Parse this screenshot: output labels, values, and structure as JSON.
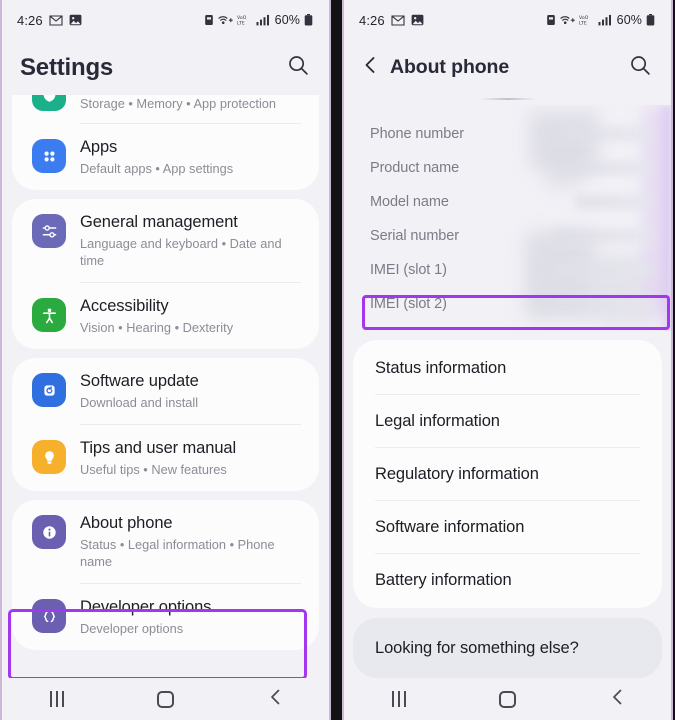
{
  "status_bar": {
    "time": "4:26",
    "left_icons": [
      "gmail-icon",
      "gallery-icon"
    ],
    "right_icons": [
      "alarm-icon",
      "wifi-calling-icon",
      "volte-icon",
      "signal-icon"
    ],
    "battery_percent": "60%"
  },
  "nav_bar": {
    "recents_label": "recents-button",
    "home_label": "home-button",
    "back_label": "back-button"
  },
  "left_screen": {
    "title": "Settings",
    "search_icon": "search-icon",
    "groups": [
      {
        "items": [
          {
            "title": "",
            "subtitle": "Storage  •  Memory  •  App protection",
            "icon": "device-care-icon",
            "icon_color": "#19b08a",
            "clipped": true
          },
          {
            "title": "Apps",
            "subtitle": "Default apps  •  App settings",
            "icon": "apps-grid-icon",
            "icon_color": "#3b7df0",
            "clipped": false
          }
        ]
      },
      {
        "items": [
          {
            "title": "General management",
            "subtitle": "Language and keyboard  •  Date and time",
            "icon": "sliders-icon",
            "icon_color": "#6a6ab8",
            "clipped": false
          },
          {
            "title": "Accessibility",
            "subtitle": "Vision  •  Hearing  •  Dexterity",
            "icon": "accessibility-icon",
            "icon_color": "#2bab3f",
            "clipped": false
          }
        ]
      },
      {
        "items": [
          {
            "title": "Software update",
            "subtitle": "Download and install",
            "icon": "software-update-icon",
            "icon_color": "#2f6fe0",
            "clipped": false
          },
          {
            "title": "Tips and user manual",
            "subtitle": "Useful tips  •  New features",
            "icon": "lightbulb-icon",
            "icon_color": "#f6b02c",
            "clipped": false
          }
        ]
      },
      {
        "items": [
          {
            "title": "About phone",
            "subtitle": "Status  •  Legal information  •  Phone name",
            "icon": "info-circle-icon",
            "icon_color": "#6a5fb0",
            "clipped": false,
            "highlighted": true
          },
          {
            "title": "Developer options",
            "subtitle": "Developer options",
            "icon": "braces-icon",
            "icon_color": "#6a5fb0",
            "clipped": false
          }
        ]
      }
    ]
  },
  "right_screen": {
    "title": "About phone",
    "back_icon": "chevron-left-icon",
    "search_icon": "search-icon",
    "info_rows": [
      {
        "label": "Phone number",
        "value_redacted": true
      },
      {
        "label": "Product name",
        "value_redacted": true
      },
      {
        "label": "Model name",
        "value_redacted": true,
        "highlighted": true
      },
      {
        "label": "Serial number",
        "value_redacted": true
      },
      {
        "label": "IMEI (slot 1)",
        "value_redacted": true
      },
      {
        "label": "IMEI (slot 2)",
        "value_redacted": true
      }
    ],
    "list_items": [
      "Status information",
      "Legal information",
      "Regulatory information",
      "Software information",
      "Battery information"
    ],
    "footer_card": "Looking for something else?"
  },
  "highlight_color": "#a436ef"
}
